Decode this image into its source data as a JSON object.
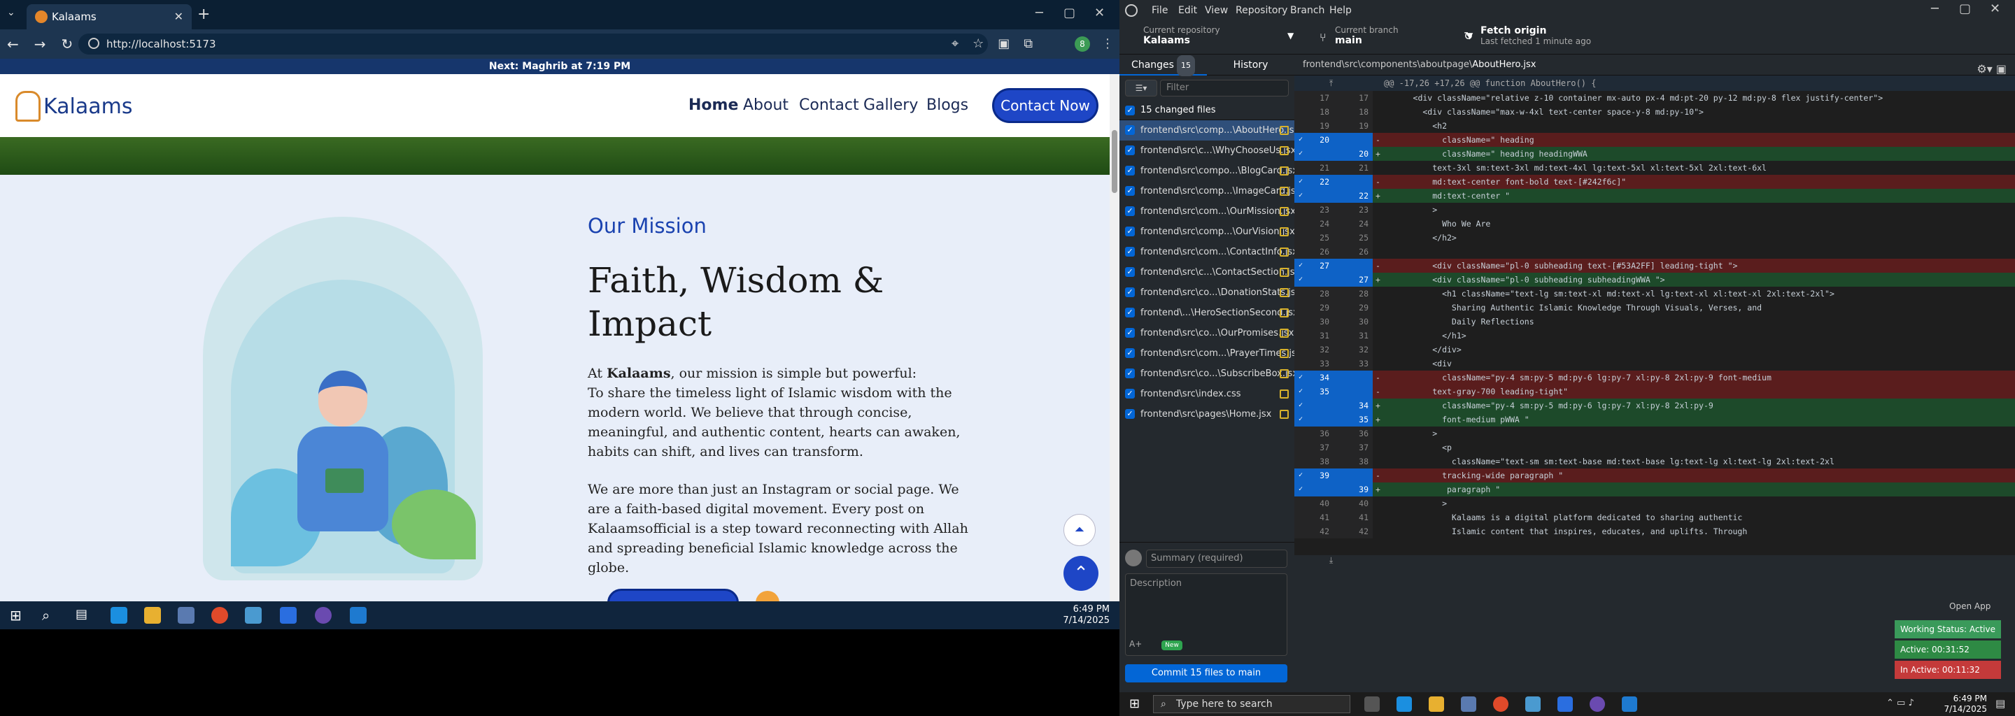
{
  "browser": {
    "tab_title": "Kalaams",
    "url": "http://localhost:5173",
    "prayer_banner": "Next: Maghrib at 7:19 PM"
  },
  "site": {
    "logo_text": "Kalaams",
    "nav": [
      "Home",
      "About",
      "Contact",
      "Gallery",
      "Blogs"
    ],
    "contact_button": "Contact Now",
    "mission": {
      "heading": "Our Mission",
      "title": "Faith, Wisdom & Impact",
      "para1_prefix": "At ",
      "para1_brand": "Kalaams",
      "para1_rest": ", our mission is simple but powerful:",
      "para1_body": "To share the timeless light of Islamic wisdom with the modern world. We believe that through concise, meaningful, and authentic content, hearts can awaken, habits can shift, and lives can transform.",
      "para2": "We are more than just an Instagram or social page. We are a faith-based digital movement. Every post on Kalaamsofficial is a step toward reconnecting with Allah and spreading beneficial Islamic knowledge across the globe."
    }
  },
  "vm_taskbar": {
    "time": "6:49 PM",
    "date": "7/14/2025"
  },
  "github": {
    "menu": [
      "File",
      "Edit",
      "View",
      "Repository",
      "Branch",
      "Help"
    ],
    "current_repo_label": "Current repository",
    "current_repo": "Kalaams",
    "current_branch_label": "Current branch",
    "current_branch": "main",
    "fetch_label": "Fetch origin",
    "fetch_sub": "Last fetched 1 minute ago",
    "tab_changes": "Changes",
    "changes_count": "15",
    "tab_history": "History",
    "filter_placeholder": "Filter",
    "changed_files_header": "15 changed files",
    "files": [
      "frontend\\src\\comp...\\AboutHero.jsx",
      "frontend\\src\\c...\\WhyChooseUs.jsx",
      "frontend\\src\\compo...\\BlogCard.jsx",
      "frontend\\src\\comp...\\ImageCard.jsx",
      "frontend\\src\\com...\\OurMission.jsx",
      "frontend\\src\\comp...\\OurVision.jsx",
      "frontend\\src\\com...\\ContactInfo.jsx",
      "frontend\\src\\c...\\ContactSection.jsx",
      "frontend\\src\\co...\\DonationStats.jsx",
      "frontend\\...\\HeroSectionSecond.jsx",
      "frontend\\src\\co...\\OurPromises.jsx",
      "frontend\\src\\com...\\PrayerTimes.jsx",
      "frontend\\src\\co...\\SubscribeBox.jsx",
      "frontend\\src\\index.css",
      "frontend\\src\\pages\\Home.jsx"
    ],
    "diff_path_prefix": "frontend\\src\\components\\aboutpage\\",
    "diff_file": "AboutHero.jsx",
    "hunk": "@@ -17,26 +17,26 @@ function AboutHero() {",
    "summary_placeholder": "Summary (required)",
    "description_placeholder": "Description",
    "new_badge": "New",
    "commit_button": "Commit 15 files to main",
    "open_app": "Open App",
    "working_status": "Working Status: Active",
    "active_time": "Active: 00:31:52",
    "inactive_time": "In Active: 00:11:32"
  },
  "diff_lines": [
    {
      "o": "17",
      "n": "17",
      "t": "ctx",
      "code": "      <div className=\"relative z-10 container mx-auto px-4 md:pt-20 py-12 md:py-8 flex justify-center\">"
    },
    {
      "o": "18",
      "n": "18",
      "t": "ctx",
      "code": "        <div className=\"max-w-4xl text-center space-y-8 md:py-10\">"
    },
    {
      "o": "19",
      "n": "19",
      "t": "ctx",
      "code": "          <h2"
    },
    {
      "o": "20",
      "n": "",
      "t": "del",
      "code": "            className=\" heading"
    },
    {
      "o": "",
      "n": "20",
      "t": "add",
      "code": "            className=\" heading headingWWA"
    },
    {
      "o": "21",
      "n": "21",
      "t": "ctx",
      "code": "          text-3xl sm:text-3xl md:text-4xl lg:text-5xl xl:text-5xl 2xl:text-6xl"
    },
    {
      "o": "22",
      "n": "",
      "t": "del",
      "code": "          md:text-center font-bold text-[#242f6c]\""
    },
    {
      "o": "",
      "n": "22",
      "t": "add",
      "code": "          md:text-center \""
    },
    {
      "o": "23",
      "n": "23",
      "t": "ctx",
      "code": "          >"
    },
    {
      "o": "24",
      "n": "24",
      "t": "ctx",
      "code": "            Who We Are"
    },
    {
      "o": "25",
      "n": "25",
      "t": "ctx",
      "code": "          </h2>"
    },
    {
      "o": "26",
      "n": "26",
      "t": "ctx",
      "code": ""
    },
    {
      "o": "27",
      "n": "",
      "t": "del",
      "code": "          <div className=\"pl-0 subheading text-[#53A2FF] leading-tight \">"
    },
    {
      "o": "",
      "n": "27",
      "t": "add",
      "code": "          <div className=\"pl-0 subheading subheadingWWA \">"
    },
    {
      "o": "28",
      "n": "28",
      "t": "ctx",
      "code": "            <h1 className=\"text-lg sm:text-xl md:text-xl lg:text-xl xl:text-xl 2xl:text-2xl\">"
    },
    {
      "o": "29",
      "n": "29",
      "t": "ctx",
      "code": "              Sharing Authentic Islamic Knowledge Through Visuals, Verses, and"
    },
    {
      "o": "30",
      "n": "30",
      "t": "ctx",
      "code": "              Daily Reflections"
    },
    {
      "o": "31",
      "n": "31",
      "t": "ctx",
      "code": "            </h1>"
    },
    {
      "o": "32",
      "n": "32",
      "t": "ctx",
      "code": "          </div>"
    },
    {
      "o": "33",
      "n": "33",
      "t": "ctx",
      "code": "          <div"
    },
    {
      "o": "34",
      "n": "",
      "t": "del",
      "code": "            className=\"py-4 sm:py-5 md:py-6 lg:py-7 xl:py-8 2xl:py-9 font-medium"
    },
    {
      "o": "35",
      "n": "",
      "t": "del",
      "code": "          text-gray-700 leading-tight\""
    },
    {
      "o": "",
      "n": "34",
      "t": "add",
      "code": "            className=\"py-4 sm:py-5 md:py-6 lg:py-7 xl:py-8 2xl:py-9"
    },
    {
      "o": "",
      "n": "35",
      "t": "add",
      "code": "            font-medium pWWA \""
    },
    {
      "o": "36",
      "n": "36",
      "t": "ctx",
      "code": "          >"
    },
    {
      "o": "37",
      "n": "37",
      "t": "ctx",
      "code": "            <p"
    },
    {
      "o": "38",
      "n": "38",
      "t": "ctx",
      "code": "              className=\"text-sm sm:text-base md:text-base lg:text-lg xl:text-lg 2xl:text-2xl"
    },
    {
      "o": "39",
      "n": "",
      "t": "del",
      "code": "            tracking-wide paragraph \""
    },
    {
      "o": "",
      "n": "39",
      "t": "add",
      "code": "             paragraph \""
    },
    {
      "o": "40",
      "n": "40",
      "t": "ctx",
      "code": "            >"
    },
    {
      "o": "41",
      "n": "41",
      "t": "ctx",
      "code": "              Kalaams is a digital platform dedicated to sharing authentic"
    },
    {
      "o": "42",
      "n": "42",
      "t": "ctx",
      "code": "              Islamic content that inspires, educates, and uplifts. Through"
    }
  ],
  "host_taskbar": {
    "search_placeholder": "Type here to search",
    "time": "6:49 PM",
    "date": "7/14/2025"
  }
}
